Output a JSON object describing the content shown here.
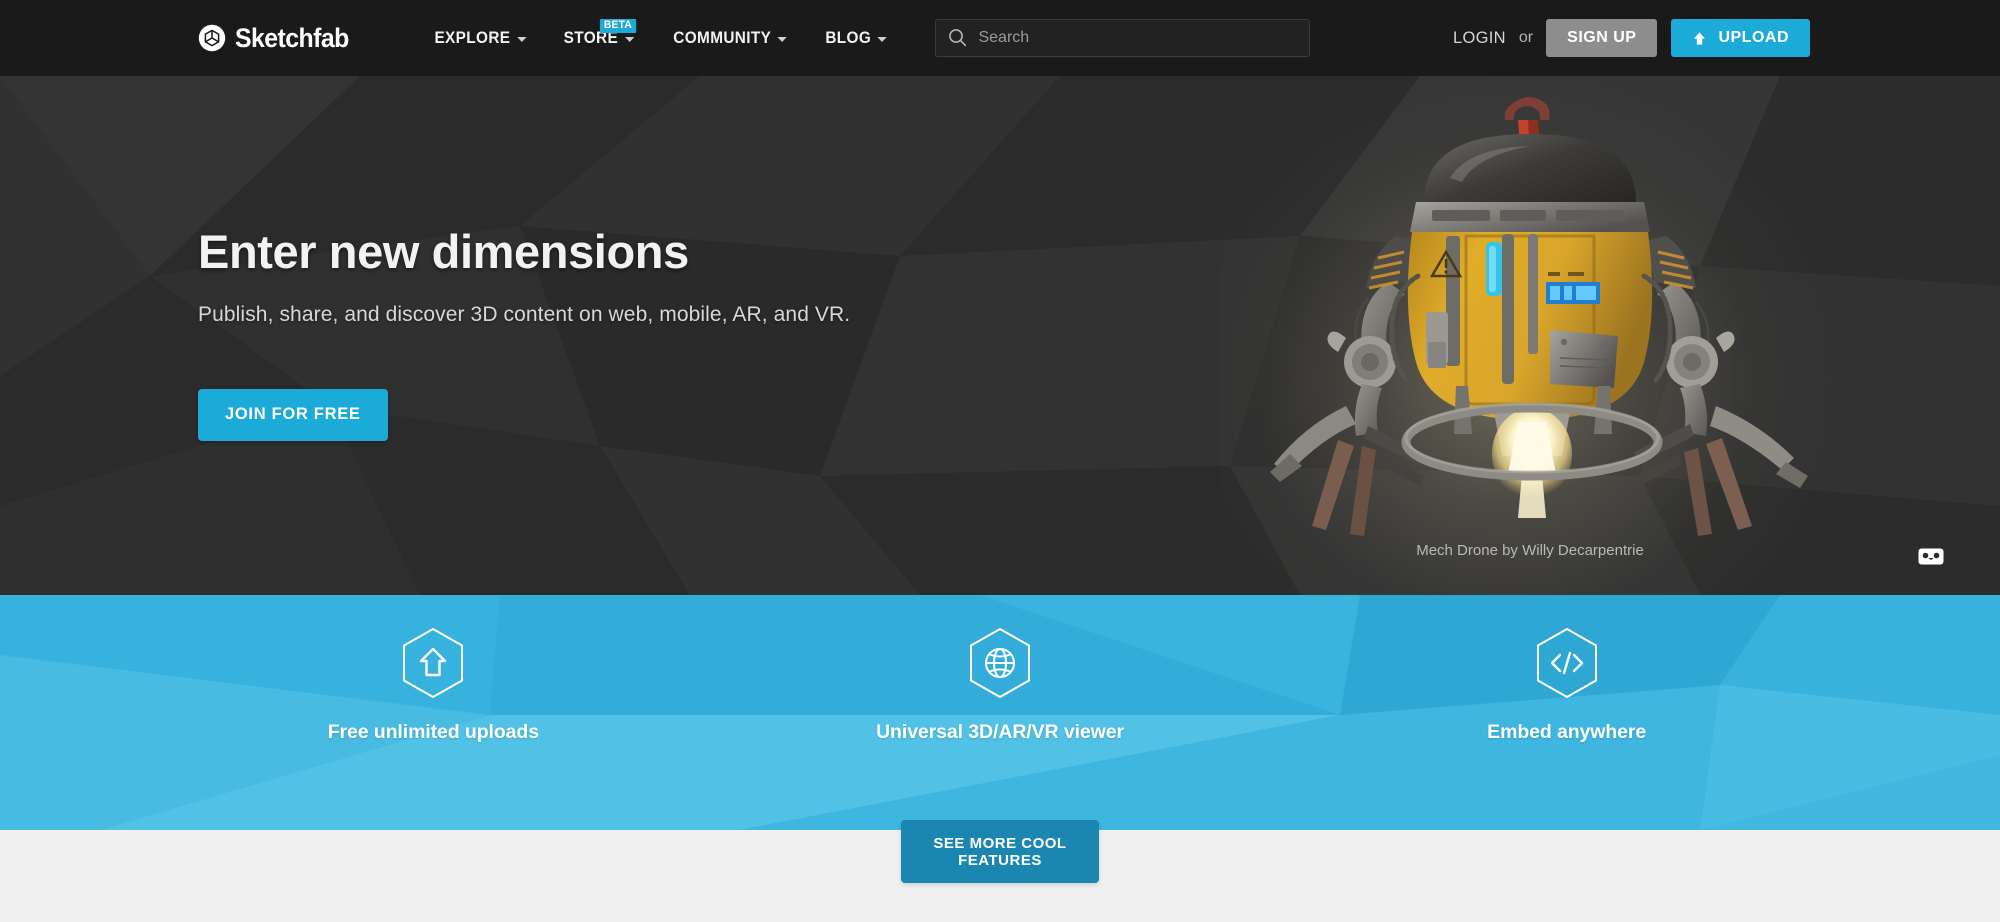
{
  "navbar": {
    "brand": {
      "name": "Sketchfab",
      "logo_icon": "sketchfab-cube-logo"
    },
    "menu": [
      {
        "label": "Explore",
        "has_caret": true,
        "badge": null
      },
      {
        "label": "Store",
        "has_caret": true,
        "badge": "BETA"
      },
      {
        "label": "Community",
        "has_caret": true,
        "badge": null
      },
      {
        "label": "Blog",
        "has_caret": true,
        "badge": null
      }
    ],
    "search": {
      "placeholder": "Search",
      "value": "",
      "icon": "search-icon"
    },
    "login_label": "Login",
    "or_label": "or",
    "signup_label": "Sign up",
    "upload_label": "Upload",
    "upload_icon": "upload-arrow-icon"
  },
  "hero": {
    "title": "Enter new dimensions",
    "subtitle": "Publish, share, and discover 3D content on web, mobile, AR, and VR.",
    "cta_label": "Join for free",
    "model_caption": "Mech Drone by Willy Decarpentrie",
    "vr_icon": "cardboard-vr-icon"
  },
  "features": {
    "items": [
      {
        "label": "Free unlimited uploads",
        "icon": "upload-hexagon-icon"
      },
      {
        "label": "Universal 3D/AR/VR viewer",
        "icon": "globe-hexagon-icon"
      },
      {
        "label": "Embed anywhere",
        "icon": "code-hexagon-icon"
      }
    ],
    "cta_label": "See more cool features"
  },
  "colors": {
    "brand_blue": "#1caad9",
    "band_blue": "#2eaad8",
    "cta_dark_blue": "#1b87b0",
    "navbar_bg": "#1a1a1a",
    "hero_bg": "#333333",
    "page_bg": "#f0f0f0",
    "signup_grey": "#8d8d8d"
  }
}
